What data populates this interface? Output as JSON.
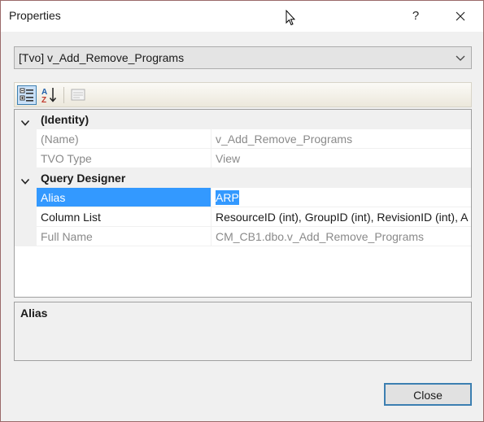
{
  "window": {
    "title": "Properties",
    "help_label": "?"
  },
  "object_selector": {
    "value": "[Tvo] v_Add_Remove_Programs"
  },
  "grid": {
    "categories": [
      {
        "name": "(Identity)",
        "properties": [
          {
            "name": "(Name)",
            "value": "v_Add_Remove_Programs"
          },
          {
            "name": "TVO Type",
            "value": "View"
          }
        ]
      },
      {
        "name": "Query Designer",
        "properties": [
          {
            "name": "Alias",
            "value": "ARP"
          },
          {
            "name": "Column List",
            "value": "ResourceID (int), GroupID (int), RevisionID (int), A"
          },
          {
            "name": "Full Name",
            "value": "CM_CB1.dbo.v_Add_Remove_Programs"
          }
        ]
      }
    ]
  },
  "description": {
    "title": "Alias"
  },
  "footer": {
    "close_label": "Close"
  }
}
